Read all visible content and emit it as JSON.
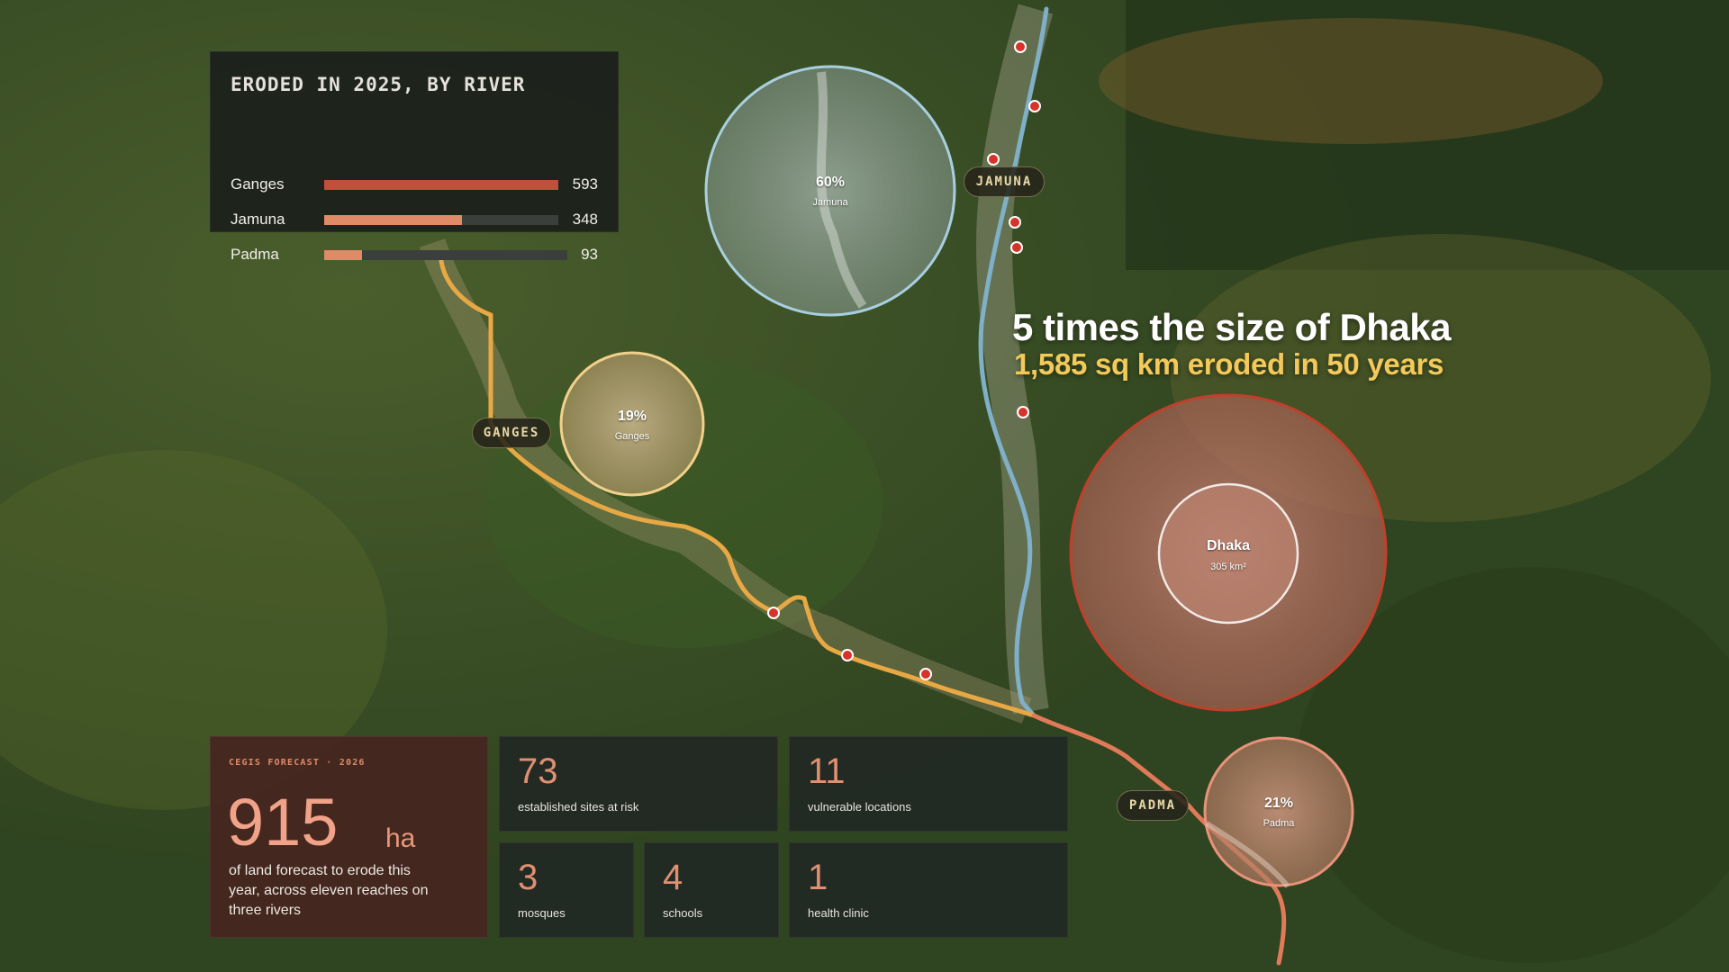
{
  "eroded_panel": {
    "title": "ERODED IN 2025, BY RIVER",
    "rivers": [
      {
        "name": "Ganges",
        "value": "593",
        "fraction": 1.0,
        "color": "#c0503a"
      },
      {
        "name": "Jamuna",
        "value": "348",
        "fraction": 0.587,
        "color": "#e08a68"
      },
      {
        "name": "Padma",
        "value": "93",
        "fraction": 0.157,
        "color": "#e08a68"
      }
    ]
  },
  "headline": {
    "main": "5 times the size of Dhaka",
    "sub": "1,585 sq km eroded in 50 years"
  },
  "river_labels": {
    "ganges": "GANGES",
    "jamuna": "JAMUNA",
    "padma": "PADMA"
  },
  "circles": {
    "jamuna": {
      "pct": "60%",
      "name": "Jamuna"
    },
    "ganges": {
      "pct": "19%",
      "name": "Ganges"
    },
    "padma": {
      "pct": "21%",
      "name": "Padma"
    },
    "dhaka": {
      "name": "Dhaka",
      "area": "305 km²"
    }
  },
  "forecast": {
    "kicker": "CEGIS FORECAST · 2026",
    "value": "915",
    "unit": "ha",
    "description": "of land forecast to erode this year, across eleven reaches on three rivers"
  },
  "stats": [
    {
      "value": "73",
      "label": "established sites at risk"
    },
    {
      "value": "11",
      "label": "vulnerable locations"
    },
    {
      "value": "3",
      "label": "mosques"
    },
    {
      "value": "4",
      "label": "schools"
    },
    {
      "value": "1",
      "label": "health clinic"
    }
  ],
  "colors": {
    "ganges_river": "#e8a844",
    "jamuna_river": "#7fb0c8",
    "padma_river": "#e07a58",
    "accent": "#e08a68",
    "headline_sub": "#f3c95a"
  }
}
